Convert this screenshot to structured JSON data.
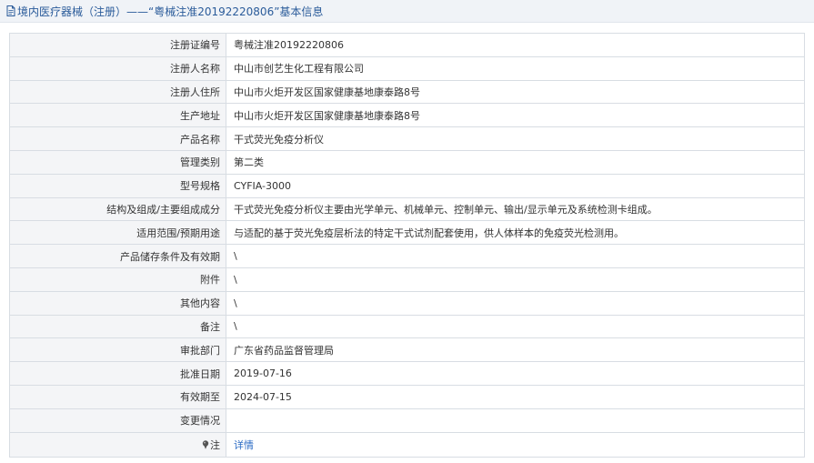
{
  "header": {
    "title": "境内医疗器械（注册）——“粤械注准20192220806”基本信息",
    "icon": "document-icon"
  },
  "rows": [
    {
      "label": "注册证编号",
      "value": "粤械注准20192220806"
    },
    {
      "label": "注册人名称",
      "value": "中山市创艺生化工程有限公司"
    },
    {
      "label": "注册人住所",
      "value": "中山市火炬开发区国家健康基地康泰路8号"
    },
    {
      "label": "生产地址",
      "value": "中山市火炬开发区国家健康基地康泰路8号"
    },
    {
      "label": "产品名称",
      "value": "干式荧光免疫分析仪"
    },
    {
      "label": "管理类别",
      "value": "第二类"
    },
    {
      "label": "型号规格",
      "value": "CYFIA-3000"
    },
    {
      "label": "结构及组成/主要组成成分",
      "value": "干式荧光免疫分析仪主要由光学单元、机械单元、控制单元、输出/显示单元及系统检测卡组成。"
    },
    {
      "label": "适用范围/预期用途",
      "value": "与适配的基于荧光免疫层析法的特定干式试剂配套使用，供人体样本的免疫荧光检测用。"
    },
    {
      "label": "产品储存条件及有效期",
      "value": "\\"
    },
    {
      "label": "附件",
      "value": "\\"
    },
    {
      "label": "其他内容",
      "value": "\\"
    },
    {
      "label": "备注",
      "value": "\\"
    },
    {
      "label": "审批部门",
      "value": "广东省药品监督管理局"
    },
    {
      "label": "批准日期",
      "value": "2019-07-16"
    },
    {
      "label": "有效期至",
      "value": "2024-07-15"
    },
    {
      "label": "变更情况",
      "value": ""
    }
  ],
  "note": {
    "label": "注",
    "icon": "pin-icon",
    "link_text": "详情"
  }
}
